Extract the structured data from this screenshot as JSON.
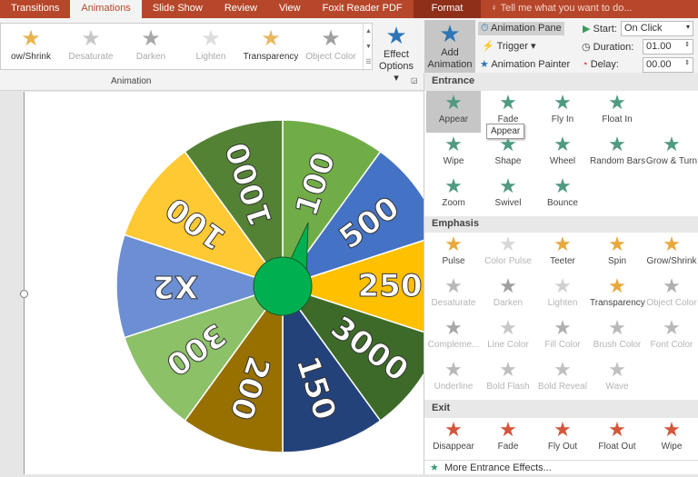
{
  "tabs": [
    "Transitions",
    "Animations",
    "Slide Show",
    "Review",
    "View",
    "Foxit Reader PDF"
  ],
  "format_tab": "Format",
  "tell_me": "Tell me what you want to do...",
  "gallery": [
    {
      "label": "ow/Shrink",
      "color": "#e8b450",
      "on": true
    },
    {
      "label": "Desaturate",
      "color": "#c8c8c8",
      "on": false
    },
    {
      "label": "Darken",
      "color": "#a8a8a8",
      "on": false
    },
    {
      "label": "Lighten",
      "color": "#dcdcdc",
      "on": false
    },
    {
      "label": "Transparency",
      "color": "#eab862",
      "on": true
    },
    {
      "label": "Object Color",
      "color": "#a0a0a0",
      "on": false
    }
  ],
  "effect_options": [
    "Effect",
    "Options ▾"
  ],
  "add_animation": [
    "Add",
    "Animation ▾"
  ],
  "animation_pane": "Animation Pane",
  "trigger": "Trigger ▾",
  "animation_painter": "Animation Painter",
  "start_label": "Start:",
  "start_value": "On Click",
  "duration_label": "Duration:",
  "duration_value": "01.00",
  "delay_label": "Delay:",
  "delay_value": "00.00",
  "group_label": "Animation",
  "menu": {
    "entrance_title": "Entrance",
    "entrance": [
      "Appear",
      "Fade",
      "Fly In",
      "Float In",
      "Wipe",
      "Shape",
      "Wheel",
      "Random Bars",
      "Grow & Turn",
      "Zoom",
      "Swivel",
      "Bounce"
    ],
    "emphasis_title": "Emphasis",
    "emphasis": [
      {
        "label": "Pulse",
        "dis": false,
        "color": "#e8a83c"
      },
      {
        "label": "Color Pulse",
        "dis": true,
        "color": "#d8d8d8"
      },
      {
        "label": "Teeter",
        "dis": false,
        "color": "#e8a83c"
      },
      {
        "label": "Spin",
        "dis": false,
        "color": "#e8a83c"
      },
      {
        "label": "Grow/Shrink",
        "dis": false,
        "color": "#e8a83c"
      },
      {
        "label": "Desaturate",
        "dis": true,
        "color": "#b8b8b8"
      },
      {
        "label": "Darken",
        "dis": true,
        "color": "#a0a0a0"
      },
      {
        "label": "Lighten",
        "dis": true,
        "color": "#d0d0d0"
      },
      {
        "label": "Transparency",
        "dis": false,
        "color": "#e8a83c"
      },
      {
        "label": "Object Color",
        "dis": true,
        "color": "#b0b0b0"
      },
      {
        "label": "Compleme...",
        "dis": true,
        "color": "#a8a8a8"
      },
      {
        "label": "Line Color",
        "dis": true,
        "color": "#c8c8c8"
      },
      {
        "label": "Fill Color",
        "dis": true,
        "color": "#b0b0b0"
      },
      {
        "label": "Brush Color",
        "dis": true,
        "color": "#b8b8b8"
      },
      {
        "label": "Font Color",
        "dis": true,
        "color": "#b8b8b8"
      },
      {
        "label": "Underline",
        "dis": true,
        "color": "#b8b8b8"
      },
      {
        "label": "Bold Flash",
        "dis": true,
        "color": "#c0c0c0"
      },
      {
        "label": "Bold Reveal",
        "dis": true,
        "color": "#c0c0c0"
      },
      {
        "label": "Wave",
        "dis": true,
        "color": "#c0c0c0"
      }
    ],
    "exit_title": "Exit",
    "exit": [
      "Disappear",
      "Fade",
      "Fly Out",
      "Float Out",
      "Wipe"
    ],
    "more": "More Entrance Effects...",
    "tooltip": "Appear"
  },
  "wheel": {
    "segments": [
      {
        "label": "100",
        "color": "#70ad47"
      },
      {
        "label": "500",
        "color": "#4472c4"
      },
      {
        "label": "250",
        "color": "#ffc000"
      },
      {
        "label": "3000",
        "color": "#3d6a29"
      },
      {
        "label": "150",
        "color": "#24427a"
      },
      {
        "label": "200",
        "color": "#977000"
      },
      {
        "label": "300",
        "color": "#8cc168"
      },
      {
        "label": "X2",
        "color": "#6b8fd2"
      },
      {
        "label": "100",
        "color": "#ffc934"
      },
      {
        "label": "1000",
        "color": "#548235"
      }
    ],
    "pointer_color": "#00b050"
  }
}
